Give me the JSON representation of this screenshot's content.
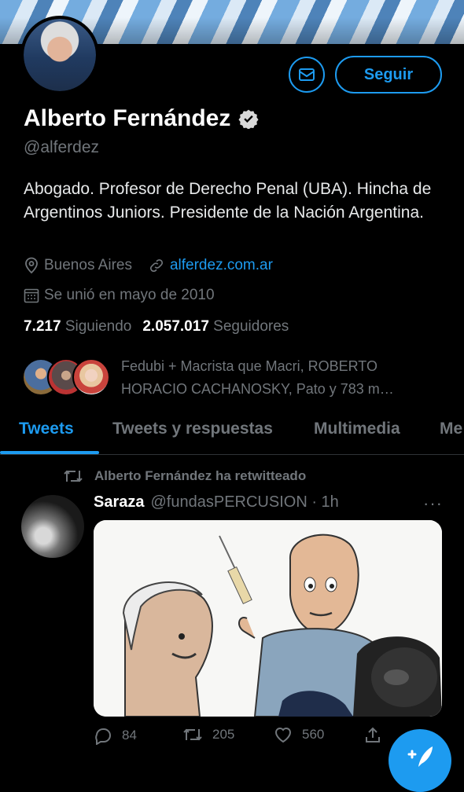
{
  "profile": {
    "name": "Alberto Fernández",
    "handle": "@alferdez",
    "bio": "Abogado. Profesor de Derecho Penal (UBA). Hincha de Argentinos Juniors. Presidente de la Nación Argentina.",
    "location": "Buenos Aires",
    "website": "alferdez.com.ar",
    "joined": "Se unió en mayo de 2010",
    "following_count": "7.217",
    "following_label": "Siguiendo",
    "followers_count": "2.057.017",
    "followers_label": "Seguidores",
    "known_followers": "Fedubi + Macrista que Macri, ROBERTO HORACIO CACHANOSKY, Pato y 783 m…"
  },
  "actions": {
    "follow_label": "Seguir",
    "message_icon": "mail-icon"
  },
  "tabs": [
    {
      "label": "Tweets",
      "active": true
    },
    {
      "label": "Tweets y respuestas",
      "active": false
    },
    {
      "label": "Multimedia",
      "active": false
    },
    {
      "label": "Me",
      "active": false
    }
  ],
  "tweet": {
    "retweet_note": "Alberto Fernández ha retwitteado",
    "author": "Saraza",
    "handle_time": "@fundasPERCUSION · 1h",
    "more": "···",
    "replies": "84",
    "retweets": "205",
    "likes": "560"
  },
  "colors": {
    "accent": "#1d9bf0",
    "background": "#000000",
    "muted": "#71767b"
  }
}
